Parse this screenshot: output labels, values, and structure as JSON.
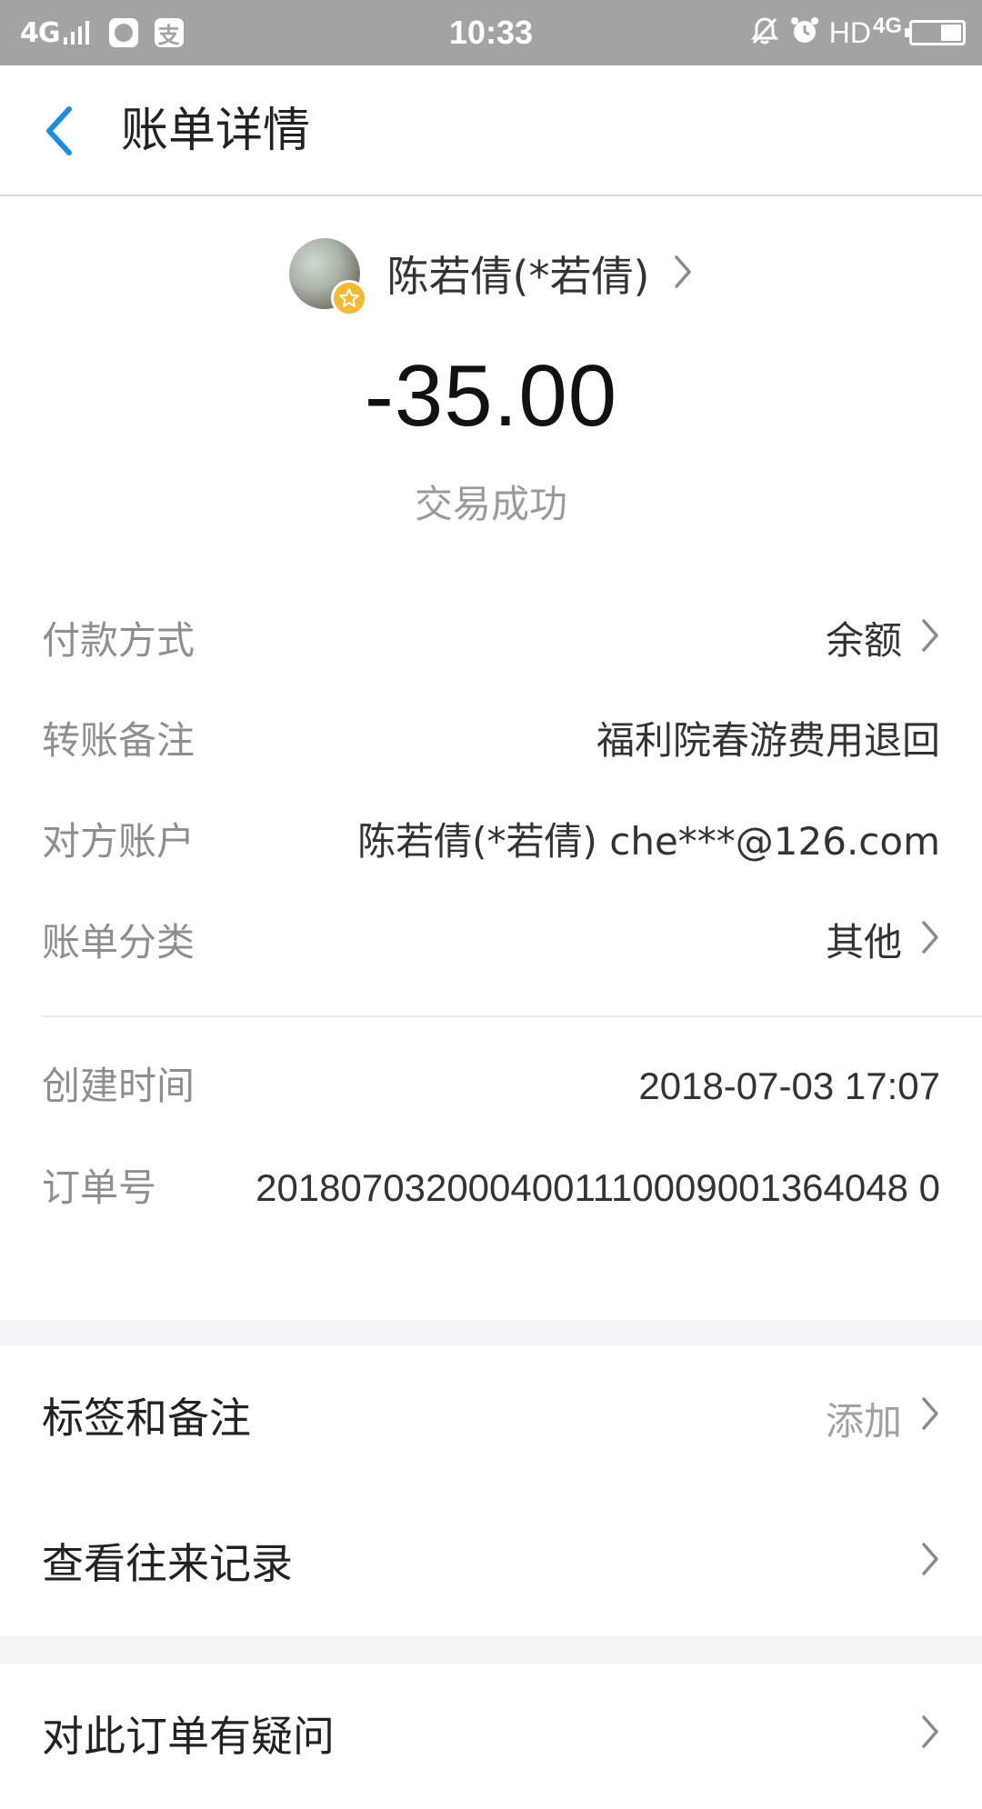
{
  "status_bar": {
    "network": "4G",
    "app_icon_1": "chat-app-icon",
    "app_icon_2": "alipay-icon",
    "app_icon_2_glyph": "支",
    "time": "10:33",
    "hd": "HD",
    "network_right": "4G",
    "icons": [
      "mute-icon",
      "alarm-icon",
      "battery-icon"
    ]
  },
  "header": {
    "back_icon": "chevron-left-icon",
    "title": "账单详情"
  },
  "summary": {
    "counterparty_name": "陈若倩(*若倩)",
    "amount": "-35.00",
    "status": "交易成功"
  },
  "details": [
    {
      "label": "付款方式",
      "value": "余额",
      "has_chevron": true
    },
    {
      "label": "转账备注",
      "value": "福利院春游费用退回",
      "has_chevron": false
    },
    {
      "label": "对方账户",
      "value": "陈若倩(*若倩) che***@126.com",
      "has_chevron": false
    },
    {
      "label": "账单分类",
      "value": "其他",
      "has_chevron": true
    }
  ],
  "meta": {
    "created_label": "创建时间",
    "created_value": "2018-07-03 17:07",
    "order_label": "订单号",
    "order_value": "2018070320004001110009001364048 0"
  },
  "actions": [
    {
      "label": "标签和备注",
      "value": "添加"
    },
    {
      "label": "查看往来记录",
      "value": ""
    },
    {
      "label": "对此订单有疑问",
      "value": ""
    }
  ],
  "colors": {
    "status_bar": "#a3a3a3",
    "accent_blue": "#1a8ee6",
    "label_gray": "#8e8e8e",
    "band_gray": "#f3f4f6",
    "badge_gold": "#f5b82e"
  }
}
